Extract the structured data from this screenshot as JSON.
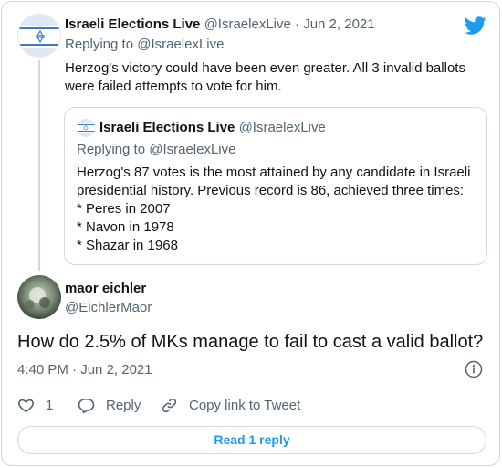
{
  "parent_tweet": {
    "display_name": "Israeli Elections Live",
    "handle": "@IsraelexLive",
    "separator": "·",
    "date": "Jun 2, 2021",
    "replying_to_prefix": "Replying to",
    "replying_to_handle": "@IsraelexLive",
    "text": "Herzog's victory could have been even greater. All 3 invalid ballots were failed attempts to vote for him."
  },
  "quoted_tweet": {
    "display_name": "Israeli Elections Live",
    "handle": "@IsraelexLive",
    "replying_to_prefix": "Replying to",
    "replying_to_handle": "@IsraelexLive",
    "lines": [
      "Herzog's 87 votes is the most attained by any candidate in Israeli",
      "presidential history. Previous record is 86, achieved three times:",
      "* Peres in 2007",
      "* Navon in 1978",
      "* Shazar in 1968"
    ]
  },
  "main_tweet": {
    "display_name": "maor eichler",
    "handle": "@EichlerMaor",
    "text": "How do 2.5% of MKs manage to fail to cast a valid ballot?",
    "time": "4:40 PM",
    "separator": "·",
    "date": "Jun 2, 2021"
  },
  "actions": {
    "like_count": "1",
    "reply_label": "Reply",
    "copy_link_label": "Copy link to Tweet"
  },
  "read_replies_label": "Read 1 reply",
  "colors": {
    "accent": "#1d9bf0",
    "muted": "#536471",
    "border": "#cfd9de"
  },
  "icons": [
    "twitter-bird-icon",
    "heart-icon",
    "reply-icon",
    "link-icon",
    "info-icon"
  ]
}
